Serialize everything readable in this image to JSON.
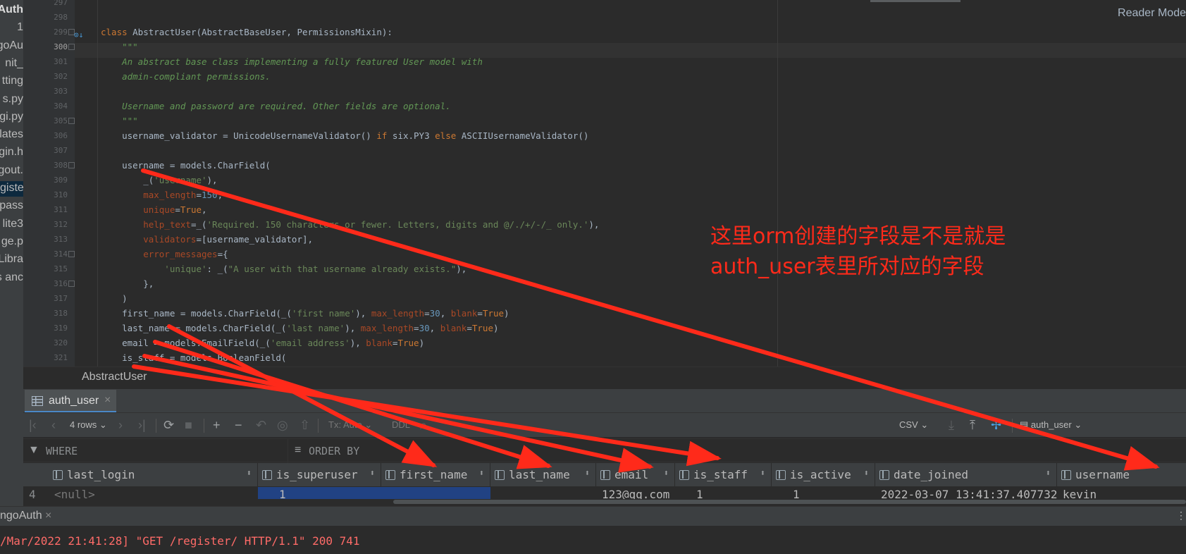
{
  "sidebar": {
    "items": [
      "Auth",
      "1",
      "goAu",
      "nit_",
      "tting",
      "s.py",
      "gi.py",
      "lates",
      "gin.h",
      "gout.",
      "giste",
      "tpass",
      "lite3",
      "ge.p",
      "Libra",
      "s anc"
    ],
    "selected_index": 10
  },
  "editor": {
    "reader_mode": "Reader Mode",
    "current_line": 300,
    "lines": [
      {
        "n": 297,
        "t": []
      },
      {
        "n": 298,
        "t": []
      },
      {
        "n": 299,
        "t": [
          [
            "kw",
            "class "
          ],
          [
            "",
            "AbstractUser(AbstractBaseUser, PermissionsMixin):"
          ]
        ]
      },
      {
        "n": 300,
        "t": [
          [
            "doc",
            "    \"\"\""
          ]
        ]
      },
      {
        "n": 301,
        "t": [
          [
            "doc",
            "    An abstract base class implementing a fully featured User model with"
          ]
        ]
      },
      {
        "n": 302,
        "t": [
          [
            "doc",
            "    admin-compliant permissions."
          ]
        ]
      },
      {
        "n": 303,
        "t": []
      },
      {
        "n": 304,
        "t": [
          [
            "doc",
            "    Username and password are required. Other fields are optional."
          ]
        ]
      },
      {
        "n": 305,
        "t": [
          [
            "doc",
            "    \"\"\""
          ]
        ]
      },
      {
        "n": 306,
        "t": [
          [
            "",
            "    username_validator = UnicodeUsernameValidator() "
          ],
          [
            "kw",
            "if "
          ],
          [
            "",
            "six.PY3 "
          ],
          [
            "kw",
            "else "
          ],
          [
            "",
            "ASCIIUsernameValidator()"
          ]
        ]
      },
      {
        "n": 307,
        "t": []
      },
      {
        "n": 308,
        "t": [
          [
            "",
            "    username = models.CharField("
          ]
        ]
      },
      {
        "n": 309,
        "t": [
          [
            "",
            "        _("
          ],
          [
            "str",
            "'username'"
          ],
          [
            "",
            "),"
          ]
        ]
      },
      {
        "n": 310,
        "t": [
          [
            "par",
            "        max_length"
          ],
          [
            "",
            "="
          ],
          [
            "num",
            "150"
          ],
          [
            "",
            ","
          ]
        ]
      },
      {
        "n": 311,
        "t": [
          [
            "par",
            "        unique"
          ],
          [
            "",
            "="
          ],
          [
            "kw",
            "True"
          ],
          [
            "",
            ","
          ]
        ]
      },
      {
        "n": 312,
        "t": [
          [
            "par",
            "        help_text"
          ],
          [
            "",
            "=_("
          ],
          [
            "str",
            "'Required. 150 characters or fewer. Letters, digits and @/./+/-/_ only.'"
          ],
          [
            "",
            "),"
          ]
        ]
      },
      {
        "n": 313,
        "t": [
          [
            "par",
            "        validators"
          ],
          [
            "",
            "=[username_validator],"
          ]
        ]
      },
      {
        "n": 314,
        "t": [
          [
            "par",
            "        error_messages"
          ],
          [
            "",
            "={"
          ]
        ]
      },
      {
        "n": 315,
        "t": [
          [
            "str",
            "            'unique'"
          ],
          [
            "",
            ": _("
          ],
          [
            "str",
            "\"A user with that username already exists.\""
          ],
          [
            "",
            "),"
          ]
        ]
      },
      {
        "n": 316,
        "t": [
          [
            "",
            "        },"
          ]
        ]
      },
      {
        "n": 317,
        "t": [
          [
            "",
            "    )"
          ]
        ]
      },
      {
        "n": 318,
        "t": [
          [
            "",
            "    first_name = models.CharField(_("
          ],
          [
            "str",
            "'first name'"
          ],
          [
            "",
            "), "
          ],
          [
            "par",
            "max_length"
          ],
          [
            "",
            "="
          ],
          [
            "num",
            "30"
          ],
          [
            "",
            ", "
          ],
          [
            "par",
            "blank"
          ],
          [
            "",
            "="
          ],
          [
            "kw",
            "True"
          ],
          [
            "",
            ")"
          ]
        ]
      },
      {
        "n": 319,
        "t": [
          [
            "",
            "    last_name = models.CharField(_("
          ],
          [
            "str",
            "'last name'"
          ],
          [
            "",
            "), "
          ],
          [
            "par",
            "max_length"
          ],
          [
            "",
            "="
          ],
          [
            "num",
            "30"
          ],
          [
            "",
            ", "
          ],
          [
            "par",
            "blank"
          ],
          [
            "",
            "="
          ],
          [
            "kw",
            "True"
          ],
          [
            "",
            ")"
          ]
        ]
      },
      {
        "n": 320,
        "t": [
          [
            "",
            "    email = models.EmailField(_("
          ],
          [
            "str",
            "'email address'"
          ],
          [
            "",
            "), "
          ],
          [
            "par",
            "blank"
          ],
          [
            "",
            "="
          ],
          [
            "kw",
            "True"
          ],
          [
            "",
            ")"
          ]
        ]
      },
      {
        "n": 321,
        "t": [
          [
            "",
            "    is_staff = models.BooleanField("
          ]
        ]
      }
    ]
  },
  "breadcrumb": "AbstractUser",
  "db_tab": {
    "label": "auth_user",
    "close": "×"
  },
  "toolbar": {
    "rows": "4 rows",
    "tx": "Tx: Auto",
    "ddl": "DDL",
    "export": "CSV",
    "datasource": "auth_user"
  },
  "filter": {
    "where": "WHERE",
    "order_by": "ORDER BY"
  },
  "grid": {
    "columns": [
      "last_login",
      "is_superuser",
      "first_name",
      "last_name",
      "email",
      "is_staff",
      "is_active",
      "date_joined",
      "username"
    ],
    "row_number": "4",
    "row": [
      "<null>",
      "1",
      "",
      "",
      "123@qq.com",
      "1",
      "1",
      "2022-03-07 13:41:37.407732",
      "kevin"
    ]
  },
  "run": {
    "tab_label": "ngoAuth",
    "close": "×",
    "console": "/Mar/2022 21:41:28] \"GET /register/ HTTP/1.1\" 200 741"
  },
  "annotation": {
    "line1": "这里orm创建的字段是不是就是",
    "line2": "auth_user表里所对应的字段"
  },
  "colors": {
    "annotation": "#ff2a1a",
    "selection": "#214283"
  }
}
